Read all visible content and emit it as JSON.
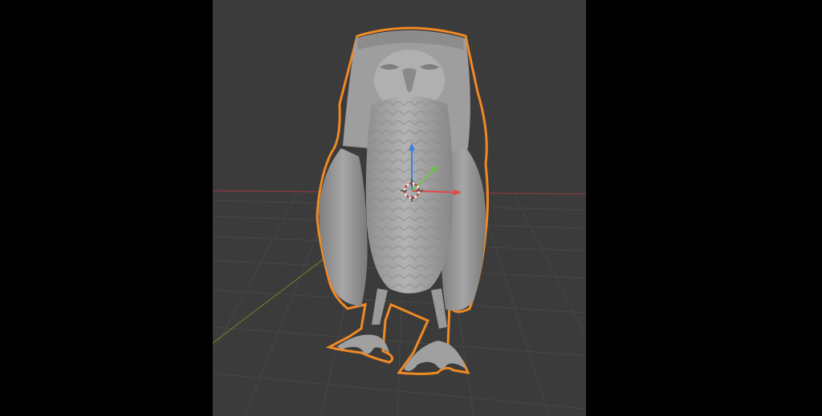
{
  "app": {
    "name": "3D viewport",
    "background_color": "#3b3b3b",
    "letterbox_color": "#000000"
  },
  "viewport": {
    "grid_color": "#4a4a4a",
    "x_axis_color": "#9b3b44",
    "y_axis_color": "#6b8a2a",
    "selection_outline_color": "#f08a24",
    "model_color": "#a9a9a9"
  },
  "gizmo": {
    "z_arrow_color": "#3f7fe0",
    "x_arrow_color": "#e24a4a",
    "y_arrow_color": "#6cc24a",
    "pivot_icon": "3d-cursor-icon"
  },
  "model": {
    "subject": "falcon-statue",
    "selected": true
  }
}
